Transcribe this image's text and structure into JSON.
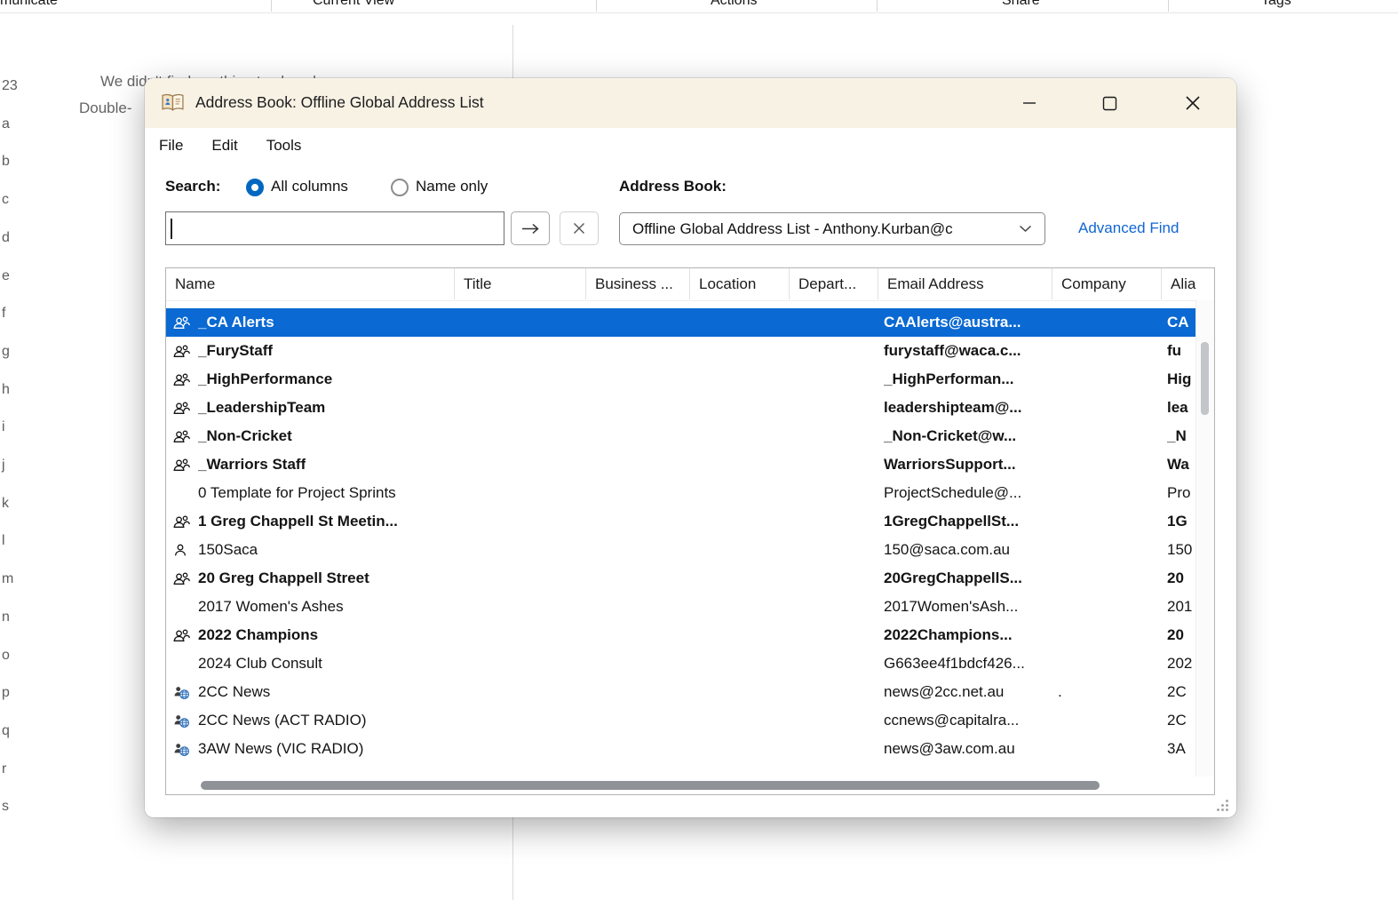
{
  "background": {
    "ribbon_groups": [
      "municate",
      "Current View",
      "Actions",
      "Share",
      "Tags"
    ],
    "empty_message": "We didn't find anything to show here.",
    "empty_message_2": "Double-",
    "index_letters": [
      "23",
      "a",
      "b",
      "c",
      "d",
      "e",
      "f",
      "g",
      "h",
      "i",
      "j",
      "k",
      "l",
      "m",
      "n",
      "o",
      "p",
      "q",
      "r",
      "s"
    ]
  },
  "dialog": {
    "title": "Address Book: Offline Global Address List",
    "menus": [
      "File",
      "Edit",
      "Tools"
    ],
    "search": {
      "label": "Search:",
      "option_all_columns": "All columns",
      "option_name_only": "Name only",
      "value": "",
      "address_book_label": "Address Book:",
      "address_book_value": "Offline Global Address List - Anthony.Kurban@c",
      "advanced_find_label": "Advanced Find"
    },
    "table": {
      "columns": [
        "Name",
        "Title",
        "Business ...",
        "Location",
        "Depart...",
        "Email Address",
        "Company",
        "Alias"
      ],
      "rows": [
        {
          "icon": "group",
          "bold": true,
          "selected": true,
          "name": "_CA Alerts",
          "email": "CAAlerts@austra...",
          "company": "",
          "alias": "CA"
        },
        {
          "icon": "group",
          "bold": true,
          "name": "_FuryStaff",
          "email": "furystaff@waca.c...",
          "company": "",
          "alias": "fu"
        },
        {
          "icon": "group",
          "bold": true,
          "name": "_HighPerformance",
          "email": "_HighPerforman...",
          "company": "",
          "alias": "Hig"
        },
        {
          "icon": "group",
          "bold": true,
          "name": "_LeadershipTeam",
          "email": "leadershipteam@...",
          "company": "",
          "alias": "lea"
        },
        {
          "icon": "group",
          "bold": true,
          "name": "_Non-Cricket",
          "email": "_Non-Cricket@w...",
          "company": "",
          "alias": "_N"
        },
        {
          "icon": "group",
          "bold": true,
          "name": "_Warriors Staff",
          "email": "WarriorsSupport...",
          "company": "",
          "alias": "Wa"
        },
        {
          "icon": "none",
          "bold": false,
          "name": "0 Template for Project Sprints",
          "email": "ProjectSchedule@...",
          "company": "",
          "alias": "Pro"
        },
        {
          "icon": "group",
          "bold": true,
          "name": "1 Greg Chappell St Meetin...",
          "email": "1GregChappellSt...",
          "company": "",
          "alias": "1G"
        },
        {
          "icon": "person",
          "bold": false,
          "name": "150Saca",
          "email": "150@saca.com.au",
          "company": "",
          "alias": "150"
        },
        {
          "icon": "group",
          "bold": true,
          "name": "20 Greg Chappell Street",
          "email": "20GregChappellS...",
          "company": "",
          "alias": "20"
        },
        {
          "icon": "none",
          "bold": false,
          "name": "2017 Women's Ashes",
          "email": "2017Women'sAsh...",
          "company": "",
          "alias": "201"
        },
        {
          "icon": "group",
          "bold": true,
          "name": "2022 Champions",
          "email": "2022Champions...",
          "company": "",
          "alias": "20"
        },
        {
          "icon": "none",
          "bold": false,
          "name": "2024 Club Consult",
          "email": "G663ee4f1bdcf426...",
          "company": "",
          "alias": "202"
        },
        {
          "icon": "globe",
          "bold": false,
          "name": "2CC News",
          "email": "news@2cc.net.au",
          "company": ".",
          "alias": "2C"
        },
        {
          "icon": "globe",
          "bold": false,
          "name": "2CC News (ACT RADIO)",
          "email": "ccnews@capitalra...",
          "company": "",
          "alias": "2C"
        },
        {
          "icon": "globe",
          "bold": false,
          "name": "3AW News (VIC RADIO)",
          "email": "news@3aw.com.au",
          "company": "",
          "alias": "3A"
        }
      ]
    }
  },
  "colors": {
    "selection_blue": "#0a69d2",
    "link_blue": "#1166d4",
    "radio_blue": "#0067c0",
    "titlebar_cream": "#f8f2e5"
  }
}
